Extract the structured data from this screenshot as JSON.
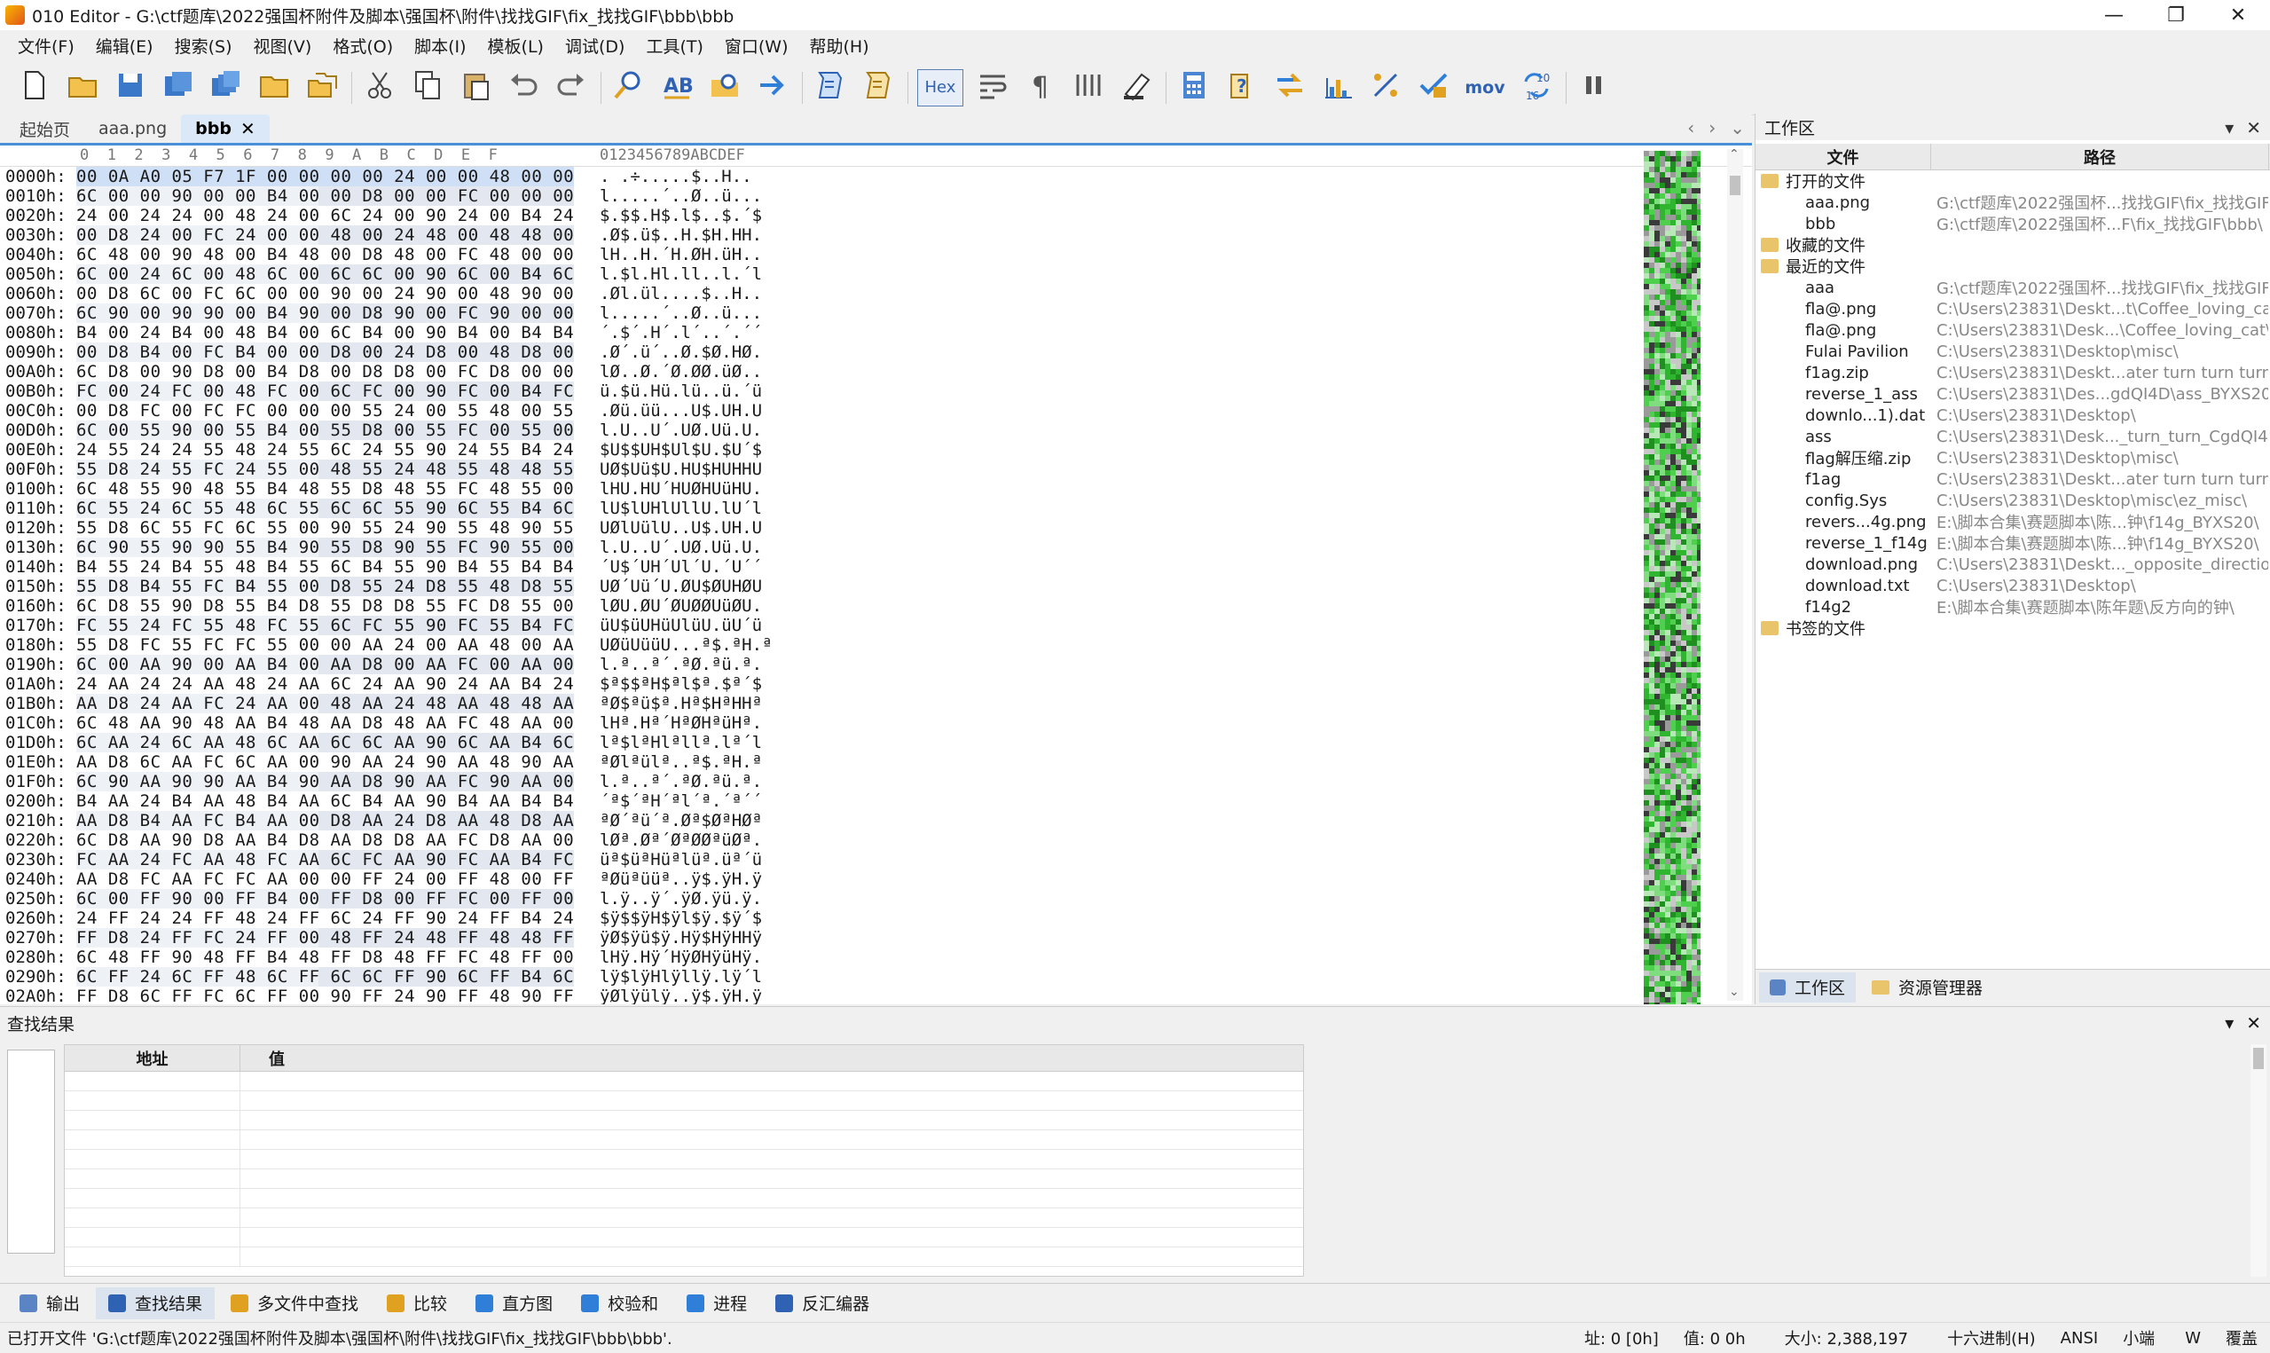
{
  "window": {
    "title": "010 Editor - G:\\ctf题库\\2022强国杯附件及脚本\\强国杯\\附件\\找找GIF\\fix_找找GIF\\bbb\\bbb",
    "minimize": "—",
    "restore": "❐",
    "close": "✕"
  },
  "menu": [
    "文件(F)",
    "编辑(E)",
    "搜索(S)",
    "视图(V)",
    "格式(O)",
    "脚本(I)",
    "模板(L)",
    "调试(D)",
    "工具(T)",
    "窗口(W)",
    "帮助(H)"
  ],
  "toolbar": {
    "hex_label": "Hex",
    "mov_label": "mov",
    "buttons": [
      "new-file-icon",
      "open-file-icon",
      "save-icon",
      "save-as-icon",
      "save-all-icon",
      "open-folder-icon",
      "workspace-icon",
      "cut-icon",
      "copy-icon",
      "paste-icon",
      "undo-icon",
      "redo-icon",
      "find-icon",
      "replace-icon",
      "find-in-files-icon",
      "goto-icon",
      "run-script-icon",
      "run-template-icon",
      "hex-toggle",
      "word-wrap-icon",
      "pilcrow-icon",
      "columns-icon",
      "highlight-icon",
      "calculator-icon",
      "help-icon",
      "swap-icon",
      "histogram-icon",
      "percent-icon",
      "checksum-icon",
      "mov-label",
      "base-convert-icon",
      "pause-icon"
    ]
  },
  "doc_tabs": [
    {
      "label": "起始页",
      "active": false
    },
    {
      "label": "aaa.png",
      "active": false
    },
    {
      "label": "bbb",
      "active": true
    }
  ],
  "hex": {
    "header_cols": "0  1  2  3  4  5  6  7  8  9  A  B  C  D  E  F",
    "header_ascii": "0123456789ABCDEF",
    "rows": [
      {
        "addr": "0000h:",
        "bytes": "00 0A A0 05 F7 1F 00 00 00 00 24 00 00 48 00 00",
        "ascii": ". .÷.....$..H.."
      },
      {
        "addr": "0010h:",
        "bytes": "6C 00 00 90 00 00 B4 00 00 D8 00 00 FC 00 00 00",
        "ascii": "l.....´..Ø..ü..."
      },
      {
        "addr": "0020h:",
        "bytes": "24 00 24 24 00 48 24 00 6C 24 00 90 24 00 B4 24",
        "ascii": "$.$$.H$.l$..$.´$"
      },
      {
        "addr": "0030h:",
        "bytes": "00 D8 24 00 FC 24 00 00 48 00 24 48 00 48 48 00",
        "ascii": ".Ø$.ü$..H.$H.HH."
      },
      {
        "addr": "0040h:",
        "bytes": "6C 48 00 90 48 00 B4 48 00 D8 48 00 FC 48 00 00",
        "ascii": "lH..H.´H.ØH.üH.."
      },
      {
        "addr": "0050h:",
        "bytes": "6C 00 24 6C 00 48 6C 00 6C 6C 00 90 6C 00 B4 6C",
        "ascii": "l.$l.Hl.ll..l.´l"
      },
      {
        "addr": "0060h:",
        "bytes": "00 D8 6C 00 FC 6C 00 00 90 00 24 90 00 48 90 00",
        "ascii": ".Øl.ül....$..H.."
      },
      {
        "addr": "0070h:",
        "bytes": "6C 90 00 90 90 00 B4 90 00 D8 90 00 FC 90 00 00",
        "ascii": "l.....´..Ø..ü..."
      },
      {
        "addr": "0080h:",
        "bytes": "B4 00 24 B4 00 48 B4 00 6C B4 00 90 B4 00 B4 B4",
        "ascii": "´.$´.H´.l´..´.´´"
      },
      {
        "addr": "0090h:",
        "bytes": "00 D8 B4 00 FC B4 00 00 D8 00 24 D8 00 48 D8 00",
        "ascii": ".Ø´.ü´..Ø.$Ø.HØ."
      },
      {
        "addr": "00A0h:",
        "bytes": "6C D8 00 90 D8 00 B4 D8 00 D8 D8 00 FC D8 00 00",
        "ascii": "lØ..Ø.´Ø.ØØ.üØ.."
      },
      {
        "addr": "00B0h:",
        "bytes": "FC 00 24 FC 00 48 FC 00 6C FC 00 90 FC 00 B4 FC",
        "ascii": "ü.$ü.Hü.lü..ü.´ü"
      },
      {
        "addr": "00C0h:",
        "bytes": "00 D8 FC 00 FC FC 00 00 00 55 24 00 55 48 00 55",
        "ascii": ".Øü.üü...U$.UH.U"
      },
      {
        "addr": "00D0h:",
        "bytes": "6C 00 55 90 00 55 B4 00 55 D8 00 55 FC 00 55 00",
        "ascii": "l.U..U´.UØ.Uü.U."
      },
      {
        "addr": "00E0h:",
        "bytes": "24 55 24 24 55 48 24 55 6C 24 55 90 24 55 B4 24",
        "ascii": "$U$$UH$Ul$U.$U´$"
      },
      {
        "addr": "00F0h:",
        "bytes": "55 D8 24 55 FC 24 55 00 48 55 24 48 55 48 48 55",
        "ascii": "UØ$Uü$U.HU$HUHHU"
      },
      {
        "addr": "0100h:",
        "bytes": "6C 48 55 90 48 55 B4 48 55 D8 48 55 FC 48 55 00",
        "ascii": "lHU.HU´HUØHUüHU."
      },
      {
        "addr": "0110h:",
        "bytes": "6C 55 24 6C 55 48 6C 55 6C 6C 55 90 6C 55 B4 6C",
        "ascii": "lU$lUHlUllU.lU´l"
      },
      {
        "addr": "0120h:",
        "bytes": "55 D8 6C 55 FC 6C 55 00 90 55 24 90 55 48 90 55",
        "ascii": "UØlUülU..U$.UH.U"
      },
      {
        "addr": "0130h:",
        "bytes": "6C 90 55 90 90 55 B4 90 55 D8 90 55 FC 90 55 00",
        "ascii": "l.U..U´.UØ.Uü.U."
      },
      {
        "addr": "0140h:",
        "bytes": "B4 55 24 B4 55 48 B4 55 6C B4 55 90 B4 55 B4 B4",
        "ascii": "´U$´UH´Ul´U.´U´´"
      },
      {
        "addr": "0150h:",
        "bytes": "55 D8 B4 55 FC B4 55 00 D8 55 24 D8 55 48 D8 55",
        "ascii": "UØ´Uü´U.ØU$ØUHØU"
      },
      {
        "addr": "0160h:",
        "bytes": "6C D8 55 90 D8 55 B4 D8 55 D8 D8 55 FC D8 55 00",
        "ascii": "lØU.ØU´ØUØØUüØU."
      },
      {
        "addr": "0170h:",
        "bytes": "FC 55 24 FC 55 48 FC 55 6C FC 55 90 FC 55 B4 FC",
        "ascii": "üU$üUHüUlüU.üU´ü"
      },
      {
        "addr": "0180h:",
        "bytes": "55 D8 FC 55 FC FC 55 00 00 AA 24 00 AA 48 00 AA",
        "ascii": "UØüUüüU...ª$.ªH.ª"
      },
      {
        "addr": "0190h:",
        "bytes": "6C 00 AA 90 00 AA B4 00 AA D8 00 AA FC 00 AA 00",
        "ascii": "l.ª..ª´.ªØ.ªü.ª."
      },
      {
        "addr": "01A0h:",
        "bytes": "24 AA 24 24 AA 48 24 AA 6C 24 AA 90 24 AA B4 24",
        "ascii": "$ª$$ªH$ªl$ª.$ª´$"
      },
      {
        "addr": "01B0h:",
        "bytes": "AA D8 24 AA FC 24 AA 00 48 AA 24 48 AA 48 48 AA",
        "ascii": "ªØ$ªü$ª.Hª$HªHHª"
      },
      {
        "addr": "01C0h:",
        "bytes": "6C 48 AA 90 48 AA B4 48 AA D8 48 AA FC 48 AA 00",
        "ascii": "lHª.Hª´HªØHªüHª."
      },
      {
        "addr": "01D0h:",
        "bytes": "6C AA 24 6C AA 48 6C AA 6C 6C AA 90 6C AA B4 6C",
        "ascii": "lª$lªHlªllª.lª´l"
      },
      {
        "addr": "01E0h:",
        "bytes": "AA D8 6C AA FC 6C AA 00 90 AA 24 90 AA 48 90 AA",
        "ascii": "ªØlªülª..ª$.ªH.ª"
      },
      {
        "addr": "01F0h:",
        "bytes": "6C 90 AA 90 90 AA B4 90 AA D8 90 AA FC 90 AA 00",
        "ascii": "l.ª..ª´.ªØ.ªü.ª."
      },
      {
        "addr": "0200h:",
        "bytes": "B4 AA 24 B4 AA 48 B4 AA 6C B4 AA 90 B4 AA B4 B4",
        "ascii": "´ª$´ªH´ªl´ª.´ª´´"
      },
      {
        "addr": "0210h:",
        "bytes": "AA D8 B4 AA FC B4 AA 00 D8 AA 24 D8 AA 48 D8 AA",
        "ascii": "ªØ´ªü´ª.Øª$ØªHØª"
      },
      {
        "addr": "0220h:",
        "bytes": "6C D8 AA 90 D8 AA B4 D8 AA D8 D8 AA FC D8 AA 00",
        "ascii": "lØª.Øª´ØªØØªüØª."
      },
      {
        "addr": "0230h:",
        "bytes": "FC AA 24 FC AA 48 FC AA 6C FC AA 90 FC AA B4 FC",
        "ascii": "üª$üªHüªlüª.üª´ü"
      },
      {
        "addr": "0240h:",
        "bytes": "AA D8 FC AA FC FC AA 00 00 FF 24 00 FF 48 00 FF",
        "ascii": "ªØüªüüª..ÿ$.ÿH.ÿ"
      },
      {
        "addr": "0250h:",
        "bytes": "6C 00 FF 90 00 FF B4 00 FF D8 00 FF FC 00 FF 00",
        "ascii": "l.ÿ..ÿ´.ÿØ.ÿü.ÿ."
      },
      {
        "addr": "0260h:",
        "bytes": "24 FF 24 24 FF 48 24 FF 6C 24 FF 90 24 FF B4 24",
        "ascii": "$ÿ$$ÿH$ÿl$ÿ.$ÿ´$"
      },
      {
        "addr": "0270h:",
        "bytes": "FF D8 24 FF FC 24 FF 00 48 FF 24 48 FF 48 48 FF",
        "ascii": "ÿØ$ÿü$ÿ.Hÿ$HÿHHÿ"
      },
      {
        "addr": "0280h:",
        "bytes": "6C 48 FF 90 48 FF B4 48 FF D8 48 FF FC 48 FF 00",
        "ascii": "lHÿ.Hÿ´HÿØHÿüHÿ."
      },
      {
        "addr": "0290h:",
        "bytes": "6C FF 24 6C FF 48 6C FF 6C 6C FF 90 6C FF B4 6C",
        "ascii": "lÿ$lÿHlÿllÿ.lÿ´l"
      },
      {
        "addr": "02A0h:",
        "bytes": "FF D8 6C FF FC 6C FF 00 90 FF 24 90 FF 48 90 FF",
        "ascii": "ÿØlÿülÿ..ÿ$.ÿH.ÿ"
      }
    ]
  },
  "workspace": {
    "title": "工作区",
    "col_file": "文件",
    "col_path": "路径",
    "groups": [
      {
        "label": "打开的文件",
        "items": [
          {
            "file": "aaa.png",
            "path": "G:\\ctf题库\\2022强国杯...找找GIF\\fix_找找GIF\\"
          },
          {
            "file": "bbb",
            "path": "G:\\ctf题库\\2022强国杯...F\\fix_找找GIF\\bbb\\"
          }
        ]
      },
      {
        "label": "收藏的文件",
        "items": []
      },
      {
        "label": "最近的文件",
        "items": [
          {
            "file": "aaa",
            "path": "G:\\ctf题库\\2022强国杯...找找GIF\\fix_找找GIF\\"
          },
          {
            "file": "fla@.png",
            "path": "C:\\Users\\23831\\Deskt...t\\Coffee_loving_cat\\"
          },
          {
            "file": "fla@.png",
            "path": "C:\\Users\\23831\\Desk...\\Coffee_loving_cat\\"
          },
          {
            "file": "Fulai Pavilion",
            "path": "C:\\Users\\23831\\Desktop\\misc\\"
          },
          {
            "file": "f1ag.zip",
            "path": "C:\\Users\\23831\\Deskt...ater turn turn turn\\"
          },
          {
            "file": "reverse_1_ass",
            "path": "C:\\Users\\23831\\Des...gdQI4D\\ass_BYXS20\\"
          },
          {
            "file": "downlo...1).dat",
            "path": "C:\\Users\\23831\\Desktop\\"
          },
          {
            "file": "ass",
            "path": "C:\\Users\\23831\\Desk..._turn_turn_CgdQI4D\\"
          },
          {
            "file": "flag解压缩.zip",
            "path": "C:\\Users\\23831\\Desktop\\misc\\"
          },
          {
            "file": "f1ag",
            "path": "C:\\Users\\23831\\Deskt...ater turn turn turn\\"
          },
          {
            "file": "config.Sys",
            "path": "C:\\Users\\23831\\Desktop\\misc\\ez_misc\\"
          },
          {
            "file": "revers...4g.png",
            "path": "E:\\脚本合集\\赛题脚本\\陈...钟\\f14g_BYXS20\\"
          },
          {
            "file": "reverse_1_f14g",
            "path": "E:\\脚本合集\\赛题脚本\\陈...钟\\f14g_BYXS20\\"
          },
          {
            "file": "download.png",
            "path": "C:\\Users\\23831\\Deskt..._opposite_direction\\"
          },
          {
            "file": "download.txt",
            "path": "C:\\Users\\23831\\Desktop\\"
          },
          {
            "file": "f14g2",
            "path": "E:\\脚本合集\\赛题脚本\\陈年题\\反方向的钟\\"
          }
        ]
      },
      {
        "label": "书签的文件",
        "items": []
      }
    ],
    "tabs": [
      "工作区",
      "资源管理器"
    ]
  },
  "find": {
    "title": "查找结果",
    "col_addr": "地址",
    "col_value": "值"
  },
  "bottom_tabs": [
    {
      "label": "输出",
      "icon": "output-icon",
      "active": false
    },
    {
      "label": "查找结果",
      "icon": "search-icon",
      "active": true
    },
    {
      "label": "多文件中查找",
      "icon": "find-multi-icon",
      "active": false
    },
    {
      "label": "比较",
      "icon": "compare-icon",
      "active": false
    },
    {
      "label": "直方图",
      "icon": "histogram-icon",
      "active": false
    },
    {
      "label": "校验和",
      "icon": "checksum-icon",
      "active": false
    },
    {
      "label": "进程",
      "icon": "process-icon",
      "active": false
    },
    {
      "label": "反汇编器",
      "icon": "disassembler-icon",
      "active": false
    }
  ],
  "status": {
    "message": "已打开文件 'G:\\ctf题库\\2022强国杯附件及脚本\\强国杯\\附件\\找找GIF\\fix_找找GIF\\bbb\\bbb'.",
    "address": "址: 0 [0h]",
    "value": "值: 0 0h",
    "size": "大小: 2,388,197",
    "mode": "十六进制(H)",
    "encoding": "ANSI",
    "endian": "小端",
    "w": "W",
    "overwrite": "覆盖"
  },
  "colors": {
    "accent": "#4a90d9",
    "selection": "#cfdff5",
    "bytemap_green": "#2fb52f"
  }
}
